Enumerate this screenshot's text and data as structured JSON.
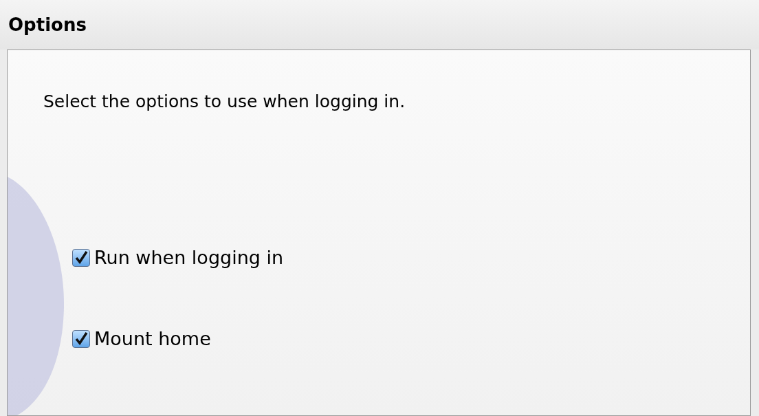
{
  "header": {
    "title": "Options"
  },
  "panel": {
    "instruction": "Select the options to use when logging in.",
    "options": [
      {
        "label": "Run when logging in",
        "checked": true
      },
      {
        "label": "Mount home",
        "checked": true
      }
    ]
  }
}
